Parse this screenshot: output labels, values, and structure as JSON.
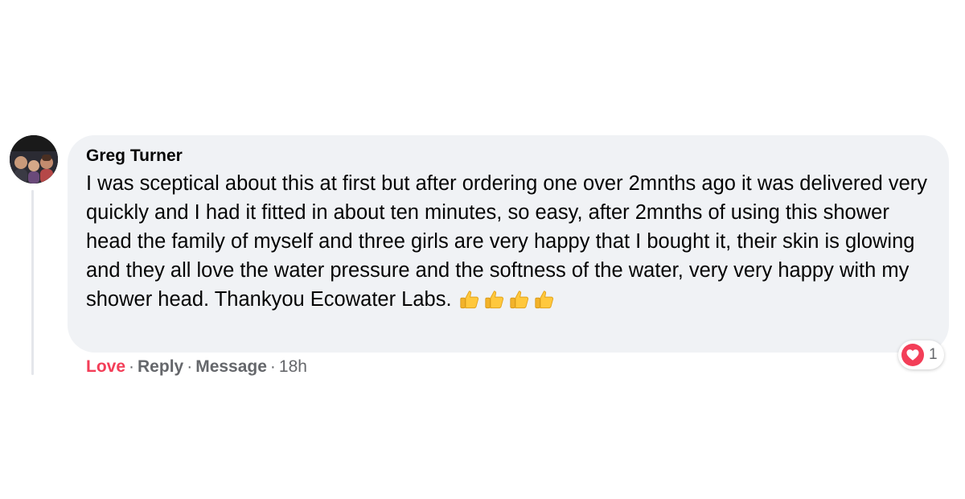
{
  "comment": {
    "author": "Greg Turner",
    "text": "I was sceptical about this at first but after ordering one over 2mnths ago it was delivered very quickly and I had it fitted in about ten minutes, so easy, after 2mnths of using this shower head the family of myself and three girls are very happy that I bought it, their skin is glowing and they all love the water pressure and the softness of the water, very very happy with my shower head. Thankyou Ecowater Labs.",
    "emoji": [
      "thumbs-up",
      "thumbs-up",
      "thumbs-up",
      "thumbs-up"
    ],
    "reaction": {
      "icon": "heart-icon",
      "count": "1"
    },
    "actions": {
      "love": "Love",
      "reply": "Reply",
      "message": "Message",
      "separator": "·",
      "time": "18h"
    }
  },
  "colors": {
    "bubble": "#f0f2f5",
    "love": "#f33e58",
    "secondary_text": "#65676b"
  }
}
